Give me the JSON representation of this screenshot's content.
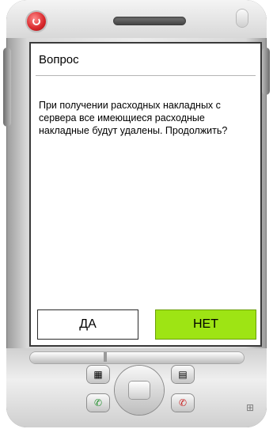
{
  "dialog": {
    "title": "Вопрос",
    "message": "При получении расходных накладных с сервера все имеющиеся расходные накладные будут удалены. Продолжить?",
    "yes_label": "ДА",
    "no_label": "НЕТ"
  },
  "device": {
    "power_icon": "power-icon",
    "keys": {
      "left_soft_icon": "contacts-icon",
      "right_soft_icon": "calendar-icon",
      "call_icon": "call-icon",
      "end_call_icon": "end-call-icon",
      "windows_icon": "windows-logo-icon"
    }
  },
  "colors": {
    "accent_button": "#9ee414",
    "screen_background": "#ffffff"
  }
}
